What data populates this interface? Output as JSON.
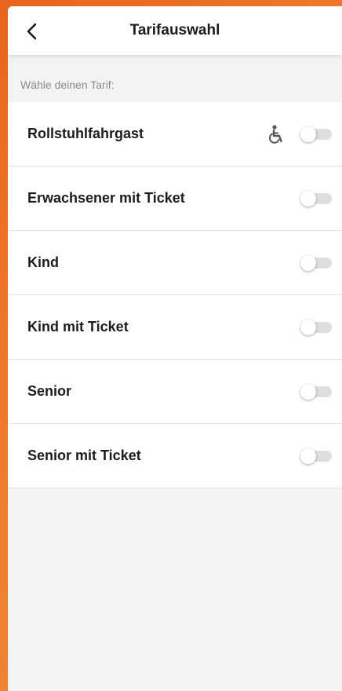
{
  "header": {
    "title": "Tarifauswahl",
    "back_icon": "chevron-left-icon"
  },
  "section_label": "Wähle deinen Tarif:",
  "tariffs": [
    {
      "label": "Rollstuhlfahrgast",
      "icon": "wheelchair-icon",
      "enabled": false
    },
    {
      "label": "Erwachsener mit Ticket",
      "enabled": false
    },
    {
      "label": "Kind",
      "enabled": false
    },
    {
      "label": "Kind mit Ticket",
      "enabled": false
    },
    {
      "label": "Senior",
      "enabled": false
    },
    {
      "label": "Senior mit Ticket",
      "enabled": false
    }
  ],
  "colors": {
    "accent_orange": "#e8651c",
    "background": "#f3f3f3",
    "toggle_off_track": "#dedede"
  }
}
